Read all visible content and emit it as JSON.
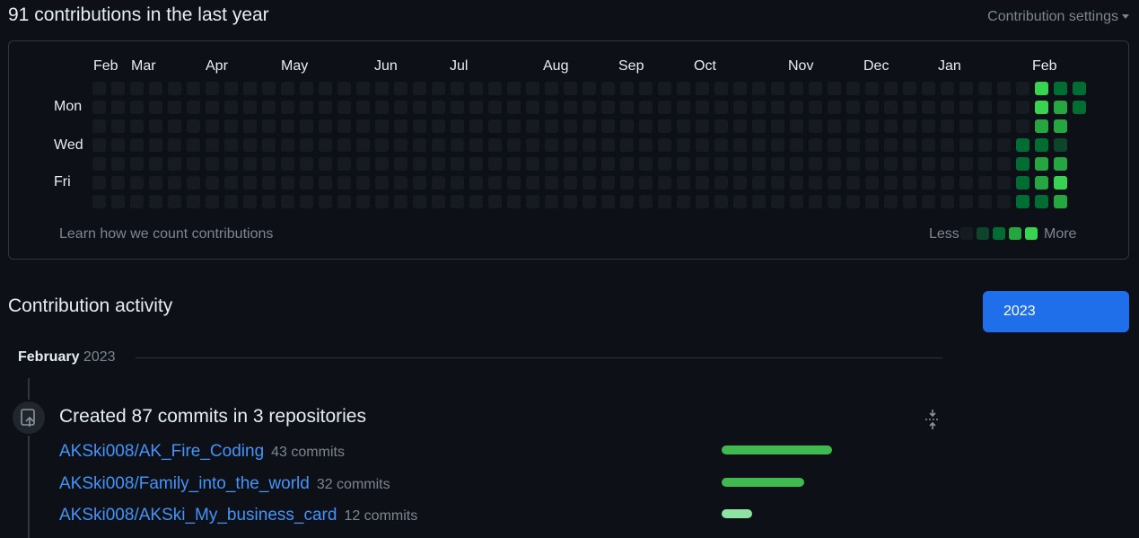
{
  "header": {
    "title": "91 contributions in the last year",
    "settings_label": "Contribution settings"
  },
  "graph": {
    "months": [
      "Feb",
      "Mar",
      "Apr",
      "May",
      "Jun",
      "Jul",
      "Aug",
      "Sep",
      "Oct",
      "Nov",
      "Dec",
      "Jan",
      "Feb"
    ],
    "day_labels": [
      "Mon",
      "Wed",
      "Fri"
    ],
    "weeks": 53,
    "active_cells": [
      {
        "week": 50,
        "day": 0,
        "level": 4
      },
      {
        "week": 50,
        "day": 1,
        "level": 4
      },
      {
        "week": 50,
        "day": 2,
        "level": 3
      },
      {
        "week": 50,
        "day": 3,
        "level": 2
      },
      {
        "week": 50,
        "day": 4,
        "level": 3
      },
      {
        "week": 50,
        "day": 5,
        "level": 3
      },
      {
        "week": 50,
        "day": 6,
        "level": 2
      },
      {
        "week": 51,
        "day": 0,
        "level": 2
      },
      {
        "week": 51,
        "day": 1,
        "level": 3
      },
      {
        "week": 51,
        "day": 2,
        "level": 3
      },
      {
        "week": 51,
        "day": 3,
        "level": 1
      },
      {
        "week": 51,
        "day": 4,
        "level": 3
      },
      {
        "week": 51,
        "day": 5,
        "level": 4
      },
      {
        "week": 51,
        "day": 6,
        "level": 3
      },
      {
        "week": 49,
        "day": 3,
        "level": 2
      },
      {
        "week": 49,
        "day": 4,
        "level": 2
      },
      {
        "week": 49,
        "day": 5,
        "level": 2
      },
      {
        "week": 49,
        "day": 6,
        "level": 2
      },
      {
        "week": 52,
        "day": 0,
        "level": 2
      },
      {
        "week": 52,
        "day": 1,
        "level": 2
      }
    ],
    "learn_link": "Learn how we count contributions",
    "legend_less": "Less",
    "legend_more": "More",
    "colors": [
      "#161b22",
      "#0e4429",
      "#006d32",
      "#26a641",
      "#39d353"
    ]
  },
  "activity": {
    "title": "Contribution activity",
    "year_button": "2023",
    "month_label": "February",
    "month_year": "2023",
    "commits_summary": "Created 87 commits in 3 repositories",
    "repos": [
      {
        "name": "AKSki008/AK_Fire_Coding",
        "count_label": "43 commits",
        "commits": 43,
        "color": "#3fb950"
      },
      {
        "name": "AKSki008/Family_into_the_world",
        "count_label": "32 commits",
        "commits": 32,
        "color": "#3fb950"
      },
      {
        "name": "AKSki008/AKSki_My_business_card",
        "count_label": "12 commits",
        "commits": 12,
        "color": "#8ee2a3"
      }
    ]
  }
}
